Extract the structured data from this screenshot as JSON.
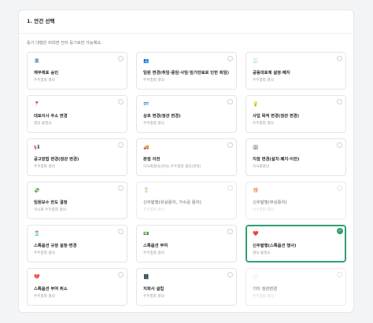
{
  "section": {
    "title": "1. 안건 선택",
    "notice": "등기 대행은 비대면 전자 등기로만 가능해요."
  },
  "cards": [
    {
      "id": "1",
      "title": "재무제표 승인",
      "desc": "주주총회 결의",
      "icon": "🏦",
      "icon_name": "bank-icon",
      "state": "normal"
    },
    {
      "id": "2",
      "title": "임원 변경(취임·중임·사임·임기만료로 인한 퇴임)",
      "desc": "주주총회 결의",
      "icon": "👥",
      "icon_name": "people-icon",
      "state": "normal"
    },
    {
      "id": "3",
      "title": "공동대표제 설정·폐지",
      "desc": "주주총회 결의",
      "icon": "🧾",
      "icon_name": "document-icon",
      "state": "normal"
    },
    {
      "id": "4",
      "title": "대표이사 주소 변경",
      "desc": "결의 불필요",
      "icon": "📍",
      "icon_name": "location-icon",
      "state": "normal"
    },
    {
      "id": "5",
      "title": "상호 변경(정관 변경)",
      "desc": "주주총회 결의",
      "icon": "🪪",
      "icon_name": "id-card-icon",
      "state": "normal"
    },
    {
      "id": "6",
      "title": "사업 목적 변경(정관 변경)",
      "desc": "주주총회 결의",
      "icon": "💡",
      "icon_name": "lightbulb-icon",
      "state": "normal"
    },
    {
      "id": "7",
      "title": "공고방법 변경(정관 변경)",
      "desc": "주주총회 결의",
      "icon": "📢",
      "icon_name": "megaphone-icon",
      "state": "normal"
    },
    {
      "id": "8",
      "title": "본점 이전",
      "desc": "이사회결의(관내) 주주총회 결의(관외)",
      "icon": "🚚",
      "icon_name": "truck-icon",
      "state": "normal"
    },
    {
      "id": "9",
      "title": "지점 변경(설치·폐지·이전)",
      "desc": "이사회결의",
      "icon": "🏢",
      "icon_name": "building-icon",
      "state": "normal"
    },
    {
      "id": "10",
      "title": "임원보수 한도 결정",
      "desc": "이사회·주주총회 결의",
      "icon": "💸",
      "icon_name": "money-icon",
      "state": "normal"
    },
    {
      "id": "11",
      "title": "신주발행(유상증자, 가수금 증자)",
      "desc": "주주총회 결의",
      "icon": "🏅",
      "icon_name": "medal-icon",
      "state": "disabled"
    },
    {
      "id": "12",
      "title": "신주발행(무상증자)",
      "desc": "주주총회 결의",
      "icon": "🎁",
      "icon_name": "gift-icon",
      "state": "disabled"
    },
    {
      "id": "13",
      "title": "스톡옵션 규정 설정·변경",
      "desc": "주주총회 결의",
      "icon": "🫙",
      "icon_name": "jar-icon",
      "state": "normal"
    },
    {
      "id": "14",
      "title": "스톡옵션 부여",
      "desc": "주주총회 결의",
      "icon": "💵",
      "icon_name": "cash-icon",
      "state": "normal"
    },
    {
      "id": "15",
      "title": "신주발행(스톡옵션 행사)",
      "desc": "결의 불필요",
      "icon": "❤️",
      "icon_name": "heart-icon",
      "state": "selected"
    },
    {
      "id": "16",
      "title": "스톡옵션 부여 취소",
      "desc": "주주총회 결의",
      "icon": "💔",
      "icon_name": "broken-heart-icon",
      "state": "normal"
    },
    {
      "id": "17",
      "title": "지회사 설립",
      "desc": "주주총회 결의",
      "icon": "🗄️",
      "icon_name": "cabinet-icon",
      "state": "normal"
    },
    {
      "id": "18",
      "title": "기타 정관변경",
      "desc": "주주총회 결의",
      "icon": "📄",
      "icon_name": "page-icon",
      "state": "disabled"
    }
  ],
  "colors": {
    "accent": "#2f9f6c",
    "border": "#e4e5e8",
    "background": "#f3f4f6"
  }
}
